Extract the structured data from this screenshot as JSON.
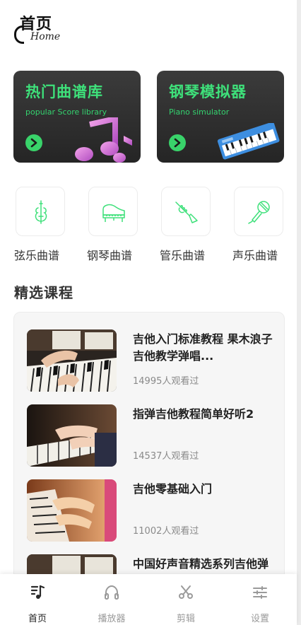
{
  "header": {
    "title": "首页",
    "subtitle": "Home"
  },
  "banners": [
    {
      "title": "热门曲谱库",
      "subtitle": "popular Score library"
    },
    {
      "title": "钢琴模拟器",
      "subtitle": "Piano simulator"
    }
  ],
  "categories": [
    {
      "label": "弦乐曲谱",
      "icon": "violin-icon"
    },
    {
      "label": "钢琴曲谱",
      "icon": "grand-piano-icon"
    },
    {
      "label": "管乐曲谱",
      "icon": "trumpet-icon"
    },
    {
      "label": "声乐曲谱",
      "icon": "microphone-icon"
    }
  ],
  "section": {
    "title": "精选课程"
  },
  "courses": [
    {
      "title": "吉他入门标准教程  果木浪子吉他教学弹唱...",
      "views": "14995人观看过"
    },
    {
      "title": "指弹吉他教程简单好听2",
      "views": "14537人观看过"
    },
    {
      "title": "吉他零基础入门",
      "views": "11002人观看过"
    },
    {
      "title": "中国好声音精选系列吉他弹唱教程",
      "views": ""
    }
  ],
  "nav": [
    {
      "label": "首页",
      "icon": "score-icon",
      "active": true
    },
    {
      "label": "播放器",
      "icon": "headphones-icon",
      "active": false
    },
    {
      "label": "剪辑",
      "icon": "scissors-icon",
      "active": false
    },
    {
      "label": "设置",
      "icon": "sliders-icon",
      "active": false
    }
  ],
  "colors": {
    "accent": "#3ee07a",
    "banner_bg": "#2e2e2e"
  }
}
